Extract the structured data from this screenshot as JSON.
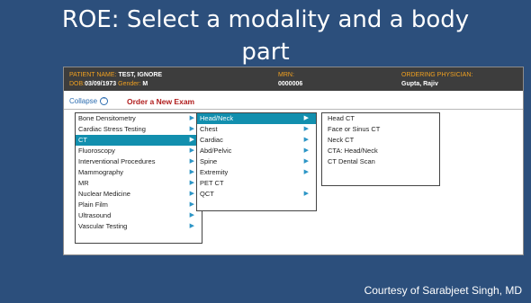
{
  "slide": {
    "title_line1": "ROE: Select a modality and a body",
    "title_line2": "part",
    "credit": "Courtesy of Sarabjeet Singh, MD"
  },
  "patient": {
    "name_label": "PATIENT NAME:",
    "name": "TEST, IGNORE",
    "dob_label": "DOB:",
    "dob": "03/09/1973",
    "gender_label": "Gender:",
    "gender": "M",
    "mrn_label": "MRN:",
    "mrn": "0000006",
    "physician_label": "ORDERING PHYSICIAN:",
    "physician": "Gupta, Rajiv"
  },
  "exam": {
    "collapse_label": "Collapse",
    "collapse_icon": "chevron-up-icon",
    "title": "Order a New Exam"
  },
  "colors": {
    "slide_background": "#2c4f7c",
    "selected_item": "#128fae",
    "arrow": "#2c95c6",
    "order_title": "#b01c1c",
    "patient_bar": "#3d3d3d",
    "patient_label": "#f0a020"
  },
  "modalities": [
    {
      "label": "Bone Densitometry"
    },
    {
      "label": "Cardiac Stress Testing"
    },
    {
      "label": "CT",
      "selected": true
    },
    {
      "label": "Fluoroscopy"
    },
    {
      "label": "Interventional Procedures"
    },
    {
      "label": "Mammography"
    },
    {
      "label": "MR"
    },
    {
      "label": "Nuclear Medicine"
    },
    {
      "label": "Plain Film"
    },
    {
      "label": "Ultrasound"
    },
    {
      "label": "Vascular Testing"
    }
  ],
  "body_parts": [
    {
      "label": "Head/Neck",
      "selected": true,
      "has_arrow": true
    },
    {
      "label": "Chest",
      "has_arrow": true
    },
    {
      "label": "Cardiac",
      "has_arrow": true
    },
    {
      "label": "Abd/Pelvic",
      "has_arrow": true
    },
    {
      "label": "Spine",
      "has_arrow": true
    },
    {
      "label": "Extremity",
      "has_arrow": true
    },
    {
      "label": "PET CT",
      "has_arrow": false
    },
    {
      "label": "QCT",
      "has_arrow": true
    }
  ],
  "exams": [
    {
      "label": "Head CT"
    },
    {
      "label": "Face or Sinus CT"
    },
    {
      "label": "Neck CT"
    },
    {
      "label": "CTA: Head/Neck"
    },
    {
      "label": "CT Dental Scan"
    }
  ]
}
